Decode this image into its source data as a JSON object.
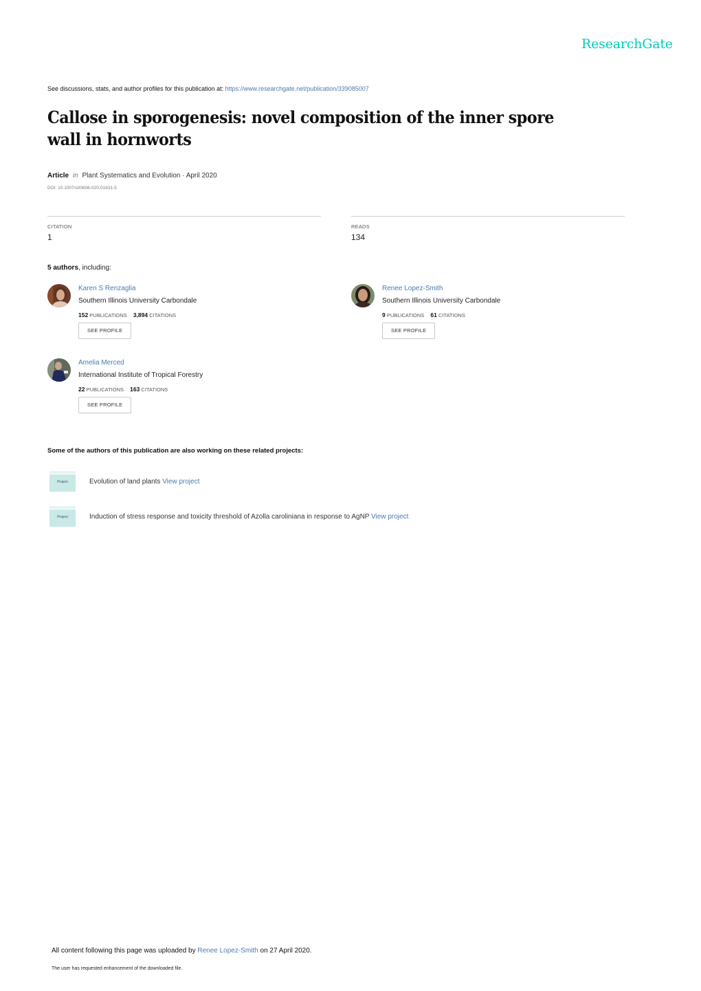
{
  "brand": {
    "name": "ResearchGate",
    "color": "#00ccbb"
  },
  "header": {
    "see_discussions_text": "See discussions, stats, and author profiles for this publication at: ",
    "publication_url": "https://www.researchgate.net/publication/339085007"
  },
  "publication": {
    "title": "Callose in sporogenesis: novel composition of the inner spore wall in hornworts",
    "type": "Article",
    "in_word": "in",
    "journal": "Plant Systematics and Evolution",
    "date_separator": " · ",
    "date": "April 2020",
    "doi": "DOI: 10.1007/s00606-020-01631-5"
  },
  "stats": {
    "citation_label": "CITATION",
    "citation_value": "1",
    "reads_label": "READS",
    "reads_value": "134"
  },
  "authors_section": {
    "count_text": "5 authors",
    "suffix": ", including:",
    "authors": [
      {
        "name": "Karen S Renzaglia",
        "institution": "Southern Illinois University Carbondale",
        "publications": "152",
        "publications_label": "PUBLICATIONS",
        "citations": "3,894",
        "citations_label": "CITATIONS",
        "button": "SEE PROFILE"
      },
      {
        "name": "Renee Lopez-Smith",
        "institution": "Southern Illinois University Carbondale",
        "publications": "9",
        "publications_label": "PUBLICATIONS",
        "citations": "61",
        "citations_label": "CITATIONS",
        "button": "SEE PROFILE"
      },
      {
        "name": "Amelia Merced",
        "institution": "International Institute of Tropical Forestry",
        "publications": "22",
        "publications_label": "PUBLICATIONS",
        "citations": "163",
        "citations_label": "CITATIONS",
        "button": "SEE PROFILE"
      }
    ]
  },
  "projects_section": {
    "heading": "Some of the authors of this publication are also working on these related projects:",
    "icon_label": "Project",
    "projects": [
      {
        "title": "Evolution of land plants",
        "link": "View project"
      },
      {
        "title": "Induction of stress response and toxicity threshold of Azolla caroliniana in response to AgNP",
        "link": "View project"
      }
    ]
  },
  "footer": {
    "upload_prefix": "All content following this page was uploaded by ",
    "uploader": "Renee Lopez-Smith",
    "upload_suffix": " on 27 April 2020.",
    "requested_text": "The user has requested enhancement of the downloaded file."
  },
  "colors": {
    "link": "#4a7bb0",
    "project_folder": "#c9e9e6"
  }
}
